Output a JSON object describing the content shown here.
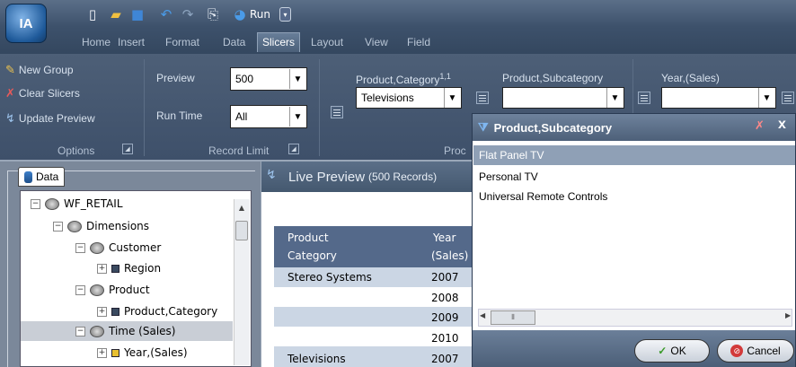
{
  "app_logo": "IA",
  "quick_access": {
    "run_label": "Run"
  },
  "tabs": [
    "Home",
    "Insert",
    "Format",
    "Data",
    "Slicers",
    "Layout",
    "View",
    "Field"
  ],
  "active_tab": "Slicers",
  "options": {
    "new_group": "New Group",
    "clear_slicers": "Clear Slicers",
    "update_preview": "Update Preview",
    "label": "Options"
  },
  "record_limit": {
    "preview_label": "Preview",
    "preview_value": "500",
    "run_time_label": "Run Time",
    "run_time_value": "All",
    "label": "Record Limit"
  },
  "slicers": {
    "group_label": "Proc",
    "product_category": {
      "label": "Product,Category",
      "superscript": "1,1",
      "value": "Televisions"
    },
    "product_subcategory": {
      "label": "Product,Subcategory",
      "value": ""
    },
    "year_sales": {
      "label": "Year,(Sales)",
      "value": ""
    }
  },
  "data_panel": {
    "tab": "Data",
    "tree": [
      {
        "label": "WF_RETAIL",
        "toggle": "⊟"
      },
      {
        "label": "Dimensions",
        "toggle": "⊟"
      },
      {
        "label": "Customer",
        "toggle": "⊟"
      },
      {
        "label": "Region",
        "toggle": "⊞"
      },
      {
        "label": "Product",
        "toggle": "⊟"
      },
      {
        "label": "Product,Category",
        "toggle": "⊞"
      },
      {
        "label": "Time (Sales)",
        "toggle": "⊟"
      },
      {
        "label": "Year,(Sales)",
        "toggle": "⊞"
      }
    ]
  },
  "preview": {
    "title": "Live Preview",
    "records": "(500 Records)",
    "headers": {
      "col1_line1": "Product",
      "col1_line2": "Category",
      "col2_line1": "Year",
      "col2_line2": "(Sales)"
    },
    "rows": [
      {
        "category": "Stereo Systems",
        "year": "2007"
      },
      {
        "category": "",
        "year": "2008"
      },
      {
        "category": "",
        "year": "2009"
      },
      {
        "category": "",
        "year": "2010"
      },
      {
        "category": "Televisions",
        "year": "2007"
      }
    ]
  },
  "popup": {
    "title": "Product,Subcategory",
    "close": "x",
    "items": [
      "Flat Panel TV",
      "Personal TV",
      "Universal Remote Controls"
    ],
    "selected_index": 0,
    "ok_label": "OK",
    "cancel_label": "Cancel"
  }
}
